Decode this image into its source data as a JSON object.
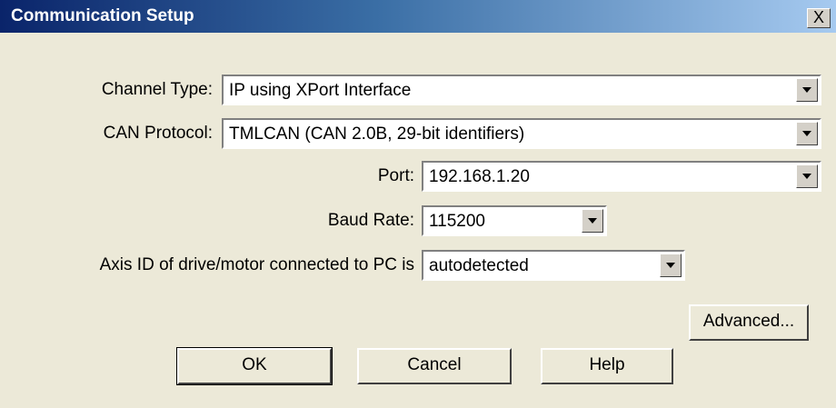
{
  "window": {
    "title": "Communication Setup",
    "close_label": "X"
  },
  "form": {
    "channel_type": {
      "label": "Channel Type:",
      "value": "IP using XPort Interface"
    },
    "can_protocol": {
      "label": "CAN Protocol:",
      "value": "TMLCAN (CAN 2.0B, 29-bit identifiers)"
    },
    "port": {
      "label": "Port:",
      "value": "192.168.1.20"
    },
    "baud_rate": {
      "label": "Baud Rate:",
      "value": "115200"
    },
    "axis_id": {
      "label": "Axis ID of drive/motor connected to PC is",
      "value": "autodetected"
    }
  },
  "buttons": {
    "advanced": "Advanced...",
    "ok": "OK",
    "cancel": "Cancel",
    "help": "Help"
  },
  "colors": {
    "titlebar_start": "#0a246a",
    "titlebar_end": "#a6caf0",
    "dialog_bg": "#ece9d8"
  }
}
